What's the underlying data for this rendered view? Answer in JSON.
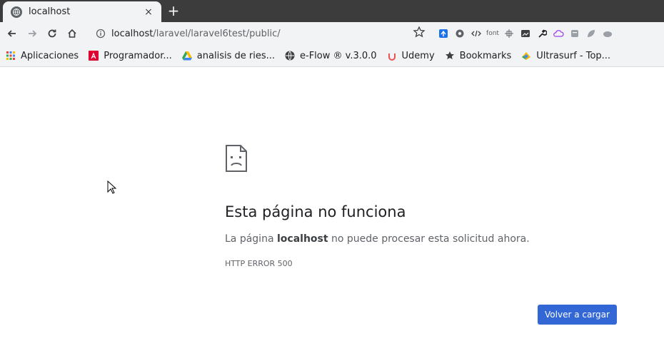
{
  "tab": {
    "title": "localhost",
    "favicon": "globe-icon",
    "close_label": "×",
    "newtab_label": "+"
  },
  "toolbar": {
    "url_host": "localhost",
    "url_path": "/laravel/laravel6test/public/"
  },
  "extensions": [
    {
      "icon": "pin-icon",
      "color": "#1a73e8"
    },
    {
      "icon": "gear-icon",
      "color": "#5f6368"
    },
    {
      "icon": "code-icon",
      "color": "#3c4043"
    },
    {
      "label": "font",
      "icon": "font-icon",
      "color": "#80868b"
    },
    {
      "icon": "crosshair-icon",
      "color": "#5f6368"
    },
    {
      "icon": "photo-icon",
      "color": "#3c4043"
    },
    {
      "icon": "tool-icon",
      "color": "#202124"
    },
    {
      "icon": "cloud-icon",
      "color": "#a142f4"
    },
    {
      "icon": "box-icon",
      "color": "#80868b"
    },
    {
      "icon": "leaf-icon",
      "color": "#80868b"
    },
    {
      "icon": "drive-icon",
      "color": "#80868b"
    }
  ],
  "bookmarks": [
    {
      "label": "Aplicaciones",
      "icon": "apps-grid-icon"
    },
    {
      "label": "Programador...",
      "icon": "angular-icon"
    },
    {
      "label": "analisis de ries...",
      "icon": "drive-icon"
    },
    {
      "label": "e-Flow ® v.3.0.0",
      "icon": "globe-icon"
    },
    {
      "label": "Udemy",
      "icon": "udemy-icon"
    },
    {
      "label": "Bookmarks",
      "icon": "star-icon"
    },
    {
      "label": "Ultrasurf - Top...",
      "icon": "ultrasurf-icon"
    }
  ],
  "page": {
    "title": "Esta página no funciona",
    "desc_prefix": "La página ",
    "desc_host": "localhost",
    "desc_suffix": " no puede procesar esta solicitud ahora.",
    "error_code": "HTTP ERROR 500",
    "reload_label": "Volver a cargar"
  },
  "colors": {
    "accent": "#3367d6",
    "tabstrip": "#3c3c3c",
    "toolbar": "#f1f3f4"
  }
}
